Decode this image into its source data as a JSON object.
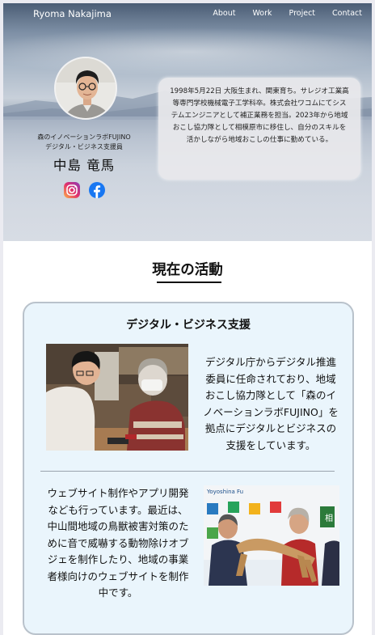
{
  "nav": {
    "brand": "Ryoma Nakajima",
    "links": [
      "About",
      "Work",
      "Project",
      "Contact"
    ]
  },
  "profile": {
    "organization_line1": "森のイノベーションラボFUJINO",
    "organization_line2": "デジタル・ビジネス支援員",
    "name": "中島 竜馬",
    "social_icons": [
      "instagram-icon",
      "facebook-icon"
    ],
    "bio": "1998年5月22日 大阪生まれ、関東育ち。サレジオ工業高等専門学校機械電子工学科卒。株式会社ワコムにてシステムエンジニアとして補正業務を担当。2023年から地域おこし協力隊として相模原市に移住し、自分のスキルを活かしながら地域おこしの仕事に勤めている。"
  },
  "activities": {
    "section_title": "現在の活動",
    "card_title": "デジタル・ビジネス支援",
    "description1": "デジタル庁からデジタル推進委員に任命されており、地域おこし協力隊として「森のイノベーションラボFUJINO」を拠点にデジタルとビジネスの支援をしています。",
    "description2": "ウェブサイト制作やアプリ開発なども行っています。最近は、中山間地域の鳥獣被害対策のために音で威嚇する動物除けオブジェを制作したり、地域の事業者様向けのウェブサイトを制作中です。",
    "photo2_banner_text": "Yoyoshina Fu",
    "photo2_sign_text": "相"
  },
  "colors": {
    "card_background": "#eaf5fc",
    "card_border": "#b9c2cb",
    "page_background": "#ebebf1",
    "instagram": "#d6249f",
    "facebook": "#1877f2"
  }
}
